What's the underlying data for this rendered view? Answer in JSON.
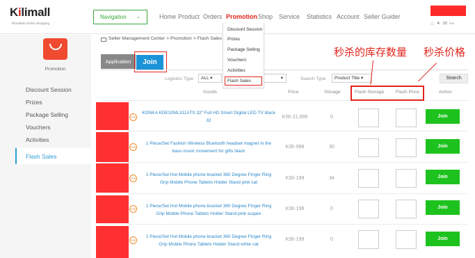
{
  "header": {
    "logo": {
      "name_prefix": "K",
      "name_i": "i",
      "name_suffix": "limall",
      "tagline": "Affordable Online Shopping"
    },
    "nav_button": "Navigation",
    "menu": [
      "Home",
      "Product",
      "Orders",
      "Promotion",
      "Shop",
      "Service",
      "Statistics",
      "Account",
      "Seller Guider"
    ],
    "active_menu": "Promotion",
    "icons": [
      "home-icon",
      "wrench-icon",
      "mail-icon",
      "logout-icon"
    ]
  },
  "dropdown": [
    "Discount Session",
    "Prizes",
    "Package Selling",
    "Vouchers",
    "Activities",
    "Flash Sales"
  ],
  "sidebar": {
    "section_label": "Promotion",
    "items": [
      "Discount Session",
      "Prizes",
      "Package Selling",
      "Vouchers",
      "Activities",
      "Flash Sales"
    ],
    "active": "Flash Sales"
  },
  "breadcrumb": "Seller Management Center > Promotion > Flash Sales",
  "tabs": {
    "application": "Application",
    "join": "Join"
  },
  "filters": {
    "logistics_label": "Logistics Type",
    "logistics_value": "ALL",
    "search_type_label": "Search Type",
    "search_type_value": "Product Title",
    "search_button": "Search"
  },
  "table": {
    "headers": [
      "Goods",
      "Price",
      "Storage",
      "Flash Storage",
      "Flash Price",
      "Action"
    ],
    "rows": [
      {
        "title": "KONKA KDE32ML311ATS 32\" Full HD Smart Digital LED TV black 32",
        "price": "KSh 21,999",
        "storage": "0",
        "action": "Join"
      },
      {
        "title": "1 Piece/Set Fashion Wireless Bluetooth headset magnet in the bass music movement for gifts black",
        "price": "KSh 999",
        "storage": "30",
        "action": "Join"
      },
      {
        "title": "1 Piece/Set Hot Mobile phone bracket 360 Degree Finger Ring Grip Mobile Phone Tablets Holder Stand pink cat",
        "price": "KSh 199",
        "storage": "34",
        "action": "Join"
      },
      {
        "title": "1 Piece/Set Hot Mobile phone bracket 360 Degree Finger Ring Grip Mobile Phone Tablets Holder Stand pink suqare",
        "price": "KSh 199",
        "storage": "0",
        "action": "Join"
      },
      {
        "title": "1 Piece/Set Hot Mobile phone bracket 360 Degree Finger Ring Grip Mobile Phone Tablets Holder Stand white cat",
        "price": "KSh 199",
        "storage": "0",
        "action": "Join"
      }
    ],
    "badge_text": "FRE"
  },
  "annotations": {
    "flash_storage": "秒杀的库存数量",
    "flash_price": "秒杀价格"
  },
  "colors": {
    "accent_red": "#e2231a",
    "join_blue": "#1b93d8",
    "join_green": "#1ec21e",
    "link_blue": "#2a86c8"
  }
}
